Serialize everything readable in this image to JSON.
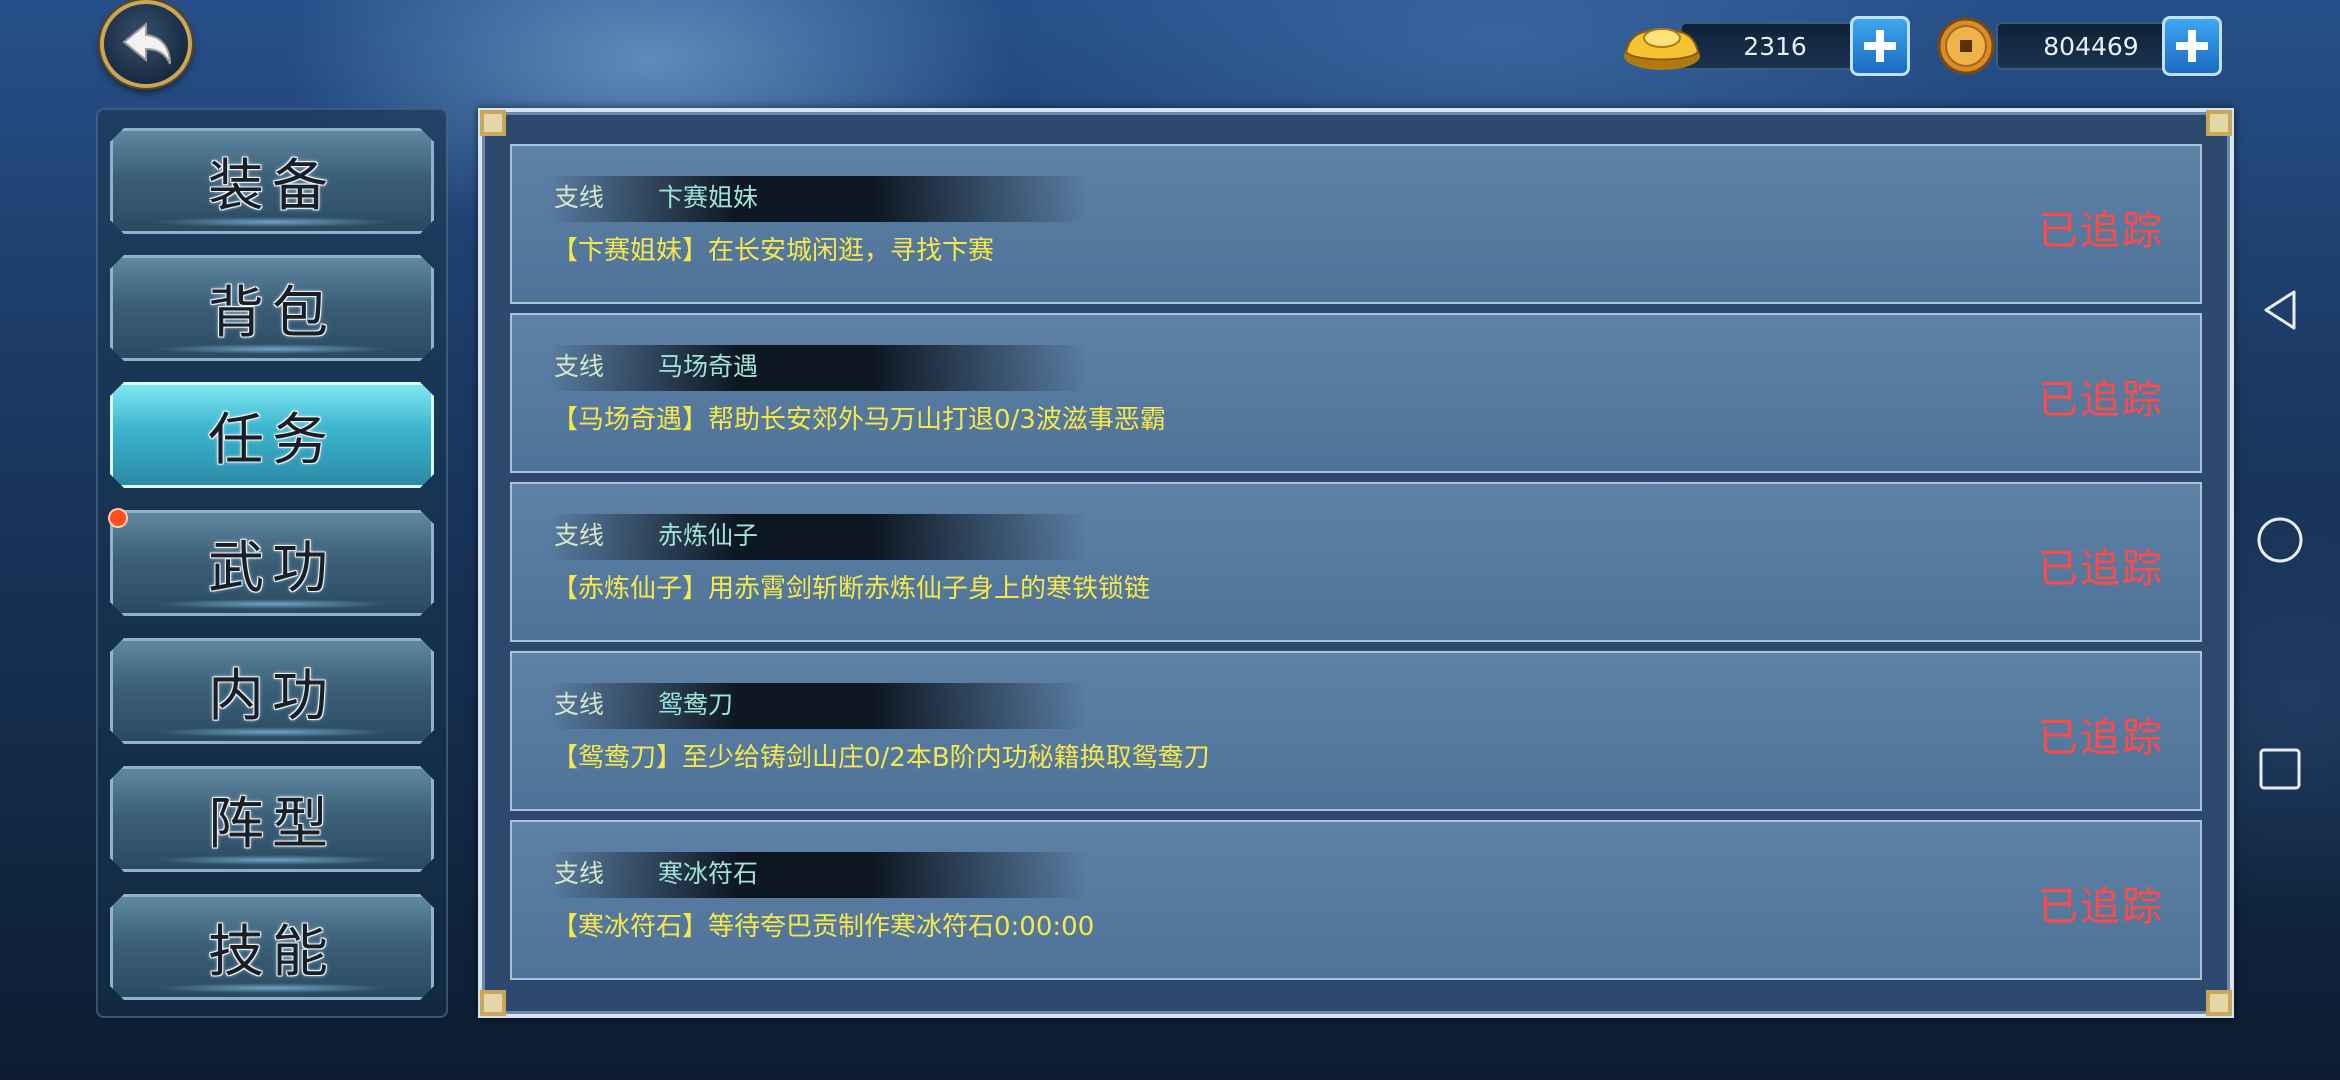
{
  "currency": {
    "gold_ingot": {
      "amount": "2316",
      "icon": "gold-ingot-icon"
    },
    "copper_coin": {
      "amount": "804469",
      "icon": "copper-coin-icon"
    }
  },
  "menu": {
    "items": [
      {
        "label": "装备",
        "active": false
      },
      {
        "label": "背包",
        "active": false
      },
      {
        "label": "任务",
        "active": true
      },
      {
        "label": "武功",
        "active": false,
        "badge": true
      },
      {
        "label": "内功",
        "active": false
      },
      {
        "label": "阵型",
        "active": false
      },
      {
        "label": "技能",
        "active": false
      }
    ]
  },
  "tasks": [
    {
      "type": "支线",
      "name": "卞赛姐妹",
      "desc": "【卞赛姐妹】在长安城闲逛，寻找卞赛",
      "status": "已追踪"
    },
    {
      "type": "支线",
      "name": "马场奇遇",
      "desc": "【马场奇遇】帮助长安郊外马万山打退0/3波滋事恶霸",
      "status": "已追踪"
    },
    {
      "type": "支线",
      "name": "赤炼仙子",
      "desc": "【赤炼仙子】用赤霄剑斩断赤炼仙子身上的寒铁锁链",
      "status": "已追踪"
    },
    {
      "type": "支线",
      "name": "鸳鸯刀",
      "desc": "【鸳鸯刀】至少给铸剑山庄0/2本B阶内功秘籍换取鸳鸯刀",
      "status": "已追踪"
    },
    {
      "type": "支线",
      "name": "寒冰符石",
      "desc": "【寒冰符石】等待夸巴贡制作寒冰符石0:00:00",
      "status": "已追踪"
    }
  ],
  "colors": {
    "status_red": "#ff4a4a",
    "desc_yellow": "#f6e84c",
    "name_cyan": "#9fe3d6",
    "active_tab": "#3ab3cc"
  }
}
